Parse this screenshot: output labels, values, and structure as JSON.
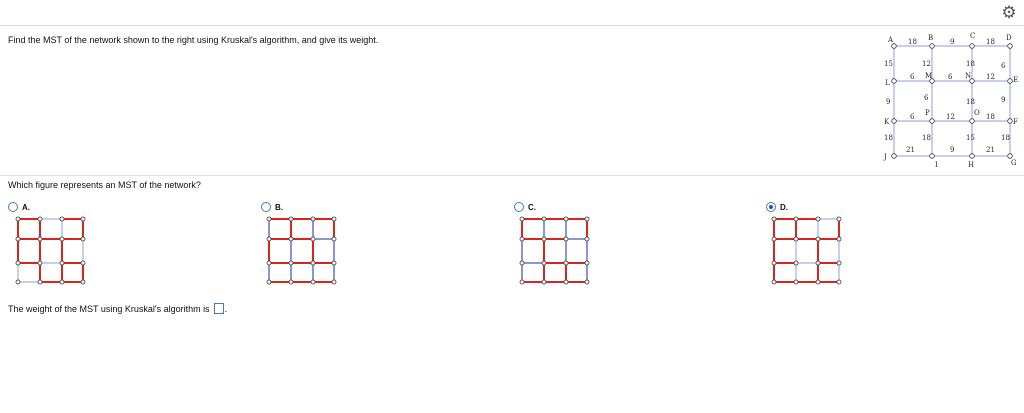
{
  "question": "Find the MST of the network shown to the right using Kruskal's algorithm, and give its weight.",
  "prompt": "Which figure represents an MST of the network?",
  "options": [
    {
      "label": "A.",
      "selected": false
    },
    {
      "label": "B.",
      "selected": false
    },
    {
      "label": "C.",
      "selected": false
    },
    {
      "label": "D.",
      "selected": true
    }
  ],
  "weight_prompt": "The weight of the MST using Kruskal's algorithm is",
  "weight_suffix": ".",
  "answer_value": "",
  "network": {
    "vertices": [
      "A",
      "B",
      "C",
      "D",
      "L",
      "M",
      "N",
      "E",
      "K",
      "P",
      "O",
      "F",
      "J",
      "I",
      "H",
      "G"
    ],
    "edge_weights": {
      "top_row": [
        "18",
        "9",
        "18"
      ],
      "row2": [
        "6",
        "6",
        "12"
      ],
      "row3": [
        "6",
        "12",
        "18"
      ],
      "bottom_row": [
        "21",
        "9",
        "21"
      ],
      "col_upper": [
        "15",
        "12",
        "18",
        "6"
      ],
      "col_middle": [
        "9",
        "6",
        "18",
        "9"
      ],
      "col_lower": [
        "18",
        "18",
        "15",
        "18"
      ]
    }
  },
  "colors": {
    "mst_edge": "#d9261c",
    "nonmst_edge": "#1a2aa8",
    "grid_edge": "#8aa0d8",
    "accent": "#1c5bb5"
  }
}
